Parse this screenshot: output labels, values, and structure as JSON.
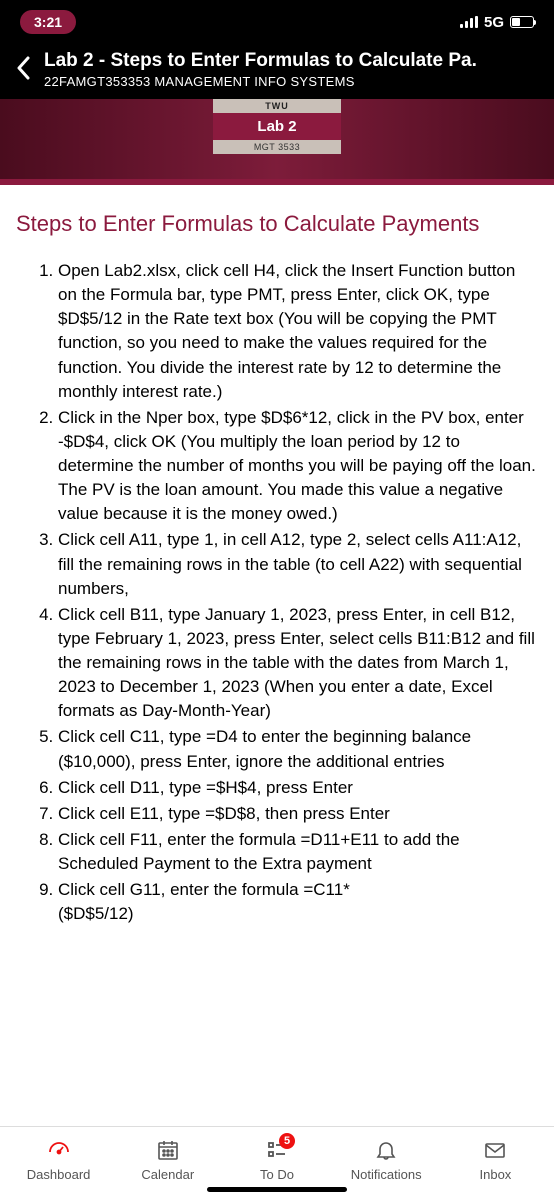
{
  "status": {
    "time": "3:21",
    "network": "5G"
  },
  "header": {
    "title": "Lab 2 - Steps to Enter Formulas to Calculate Pa.",
    "subtitle": "22FAMGT353353 MANAGEMENT INFO SYSTEMS"
  },
  "hero": {
    "top": "TWU",
    "mid": "Lab 2",
    "bot": "MGT 3533"
  },
  "page": {
    "title": "Steps to Enter Formulas to Calculate Payments",
    "steps": [
      "Open Lab2.xlsx, click cell H4, click the Insert Function button on the Formula bar, type PMT, press Enter, click OK, type $D$5/12 in the Rate text box (You will be copying the PMT function, so you need to make the values required for the function. You divide the interest rate by 12 to determine the monthly interest rate.)",
      "Click in the Nper box, type $D$6*12, click in the PV box, enter -$D$4, click OK (You multiply the loan period by 12 to determine the number of months you will be paying off the loan. The PV is the loan amount. You made this value a negative value because it is the money owed.)",
      "Click cell A11, type 1, in cell A12, type 2, select cells A11:A12, fill the remaining rows in the table (to cell A22) with sequential numbers,",
      "Click cell B11, type January 1, 2023, press Enter, in cell B12, type February 1, 2023, press Enter, select cells B11:B12 and fill the remaining rows in the table with the dates from March 1, 2023 to December 1, 2023 (When you enter a date, Excel formats as Day-Month-Year)",
      "Click cell C11, type =D4 to enter the beginning balance ($10,000), press Enter, ignore the additional entries",
      "Click cell D11, type =$H$4, press Enter",
      "Click cell E11, type =$D$8, then press Enter",
      "Click cell F11, enter the formula =D11+E11 to add the Scheduled Payment to the Extra payment",
      "Click cell G11, enter the formula =C11*"
    ],
    "truncated": "($D$5/12)"
  },
  "tabs": {
    "items": [
      {
        "label": "Dashboard"
      },
      {
        "label": "Calendar"
      },
      {
        "label": "To Do",
        "badge": "5"
      },
      {
        "label": "Notifications"
      },
      {
        "label": "Inbox"
      }
    ]
  }
}
